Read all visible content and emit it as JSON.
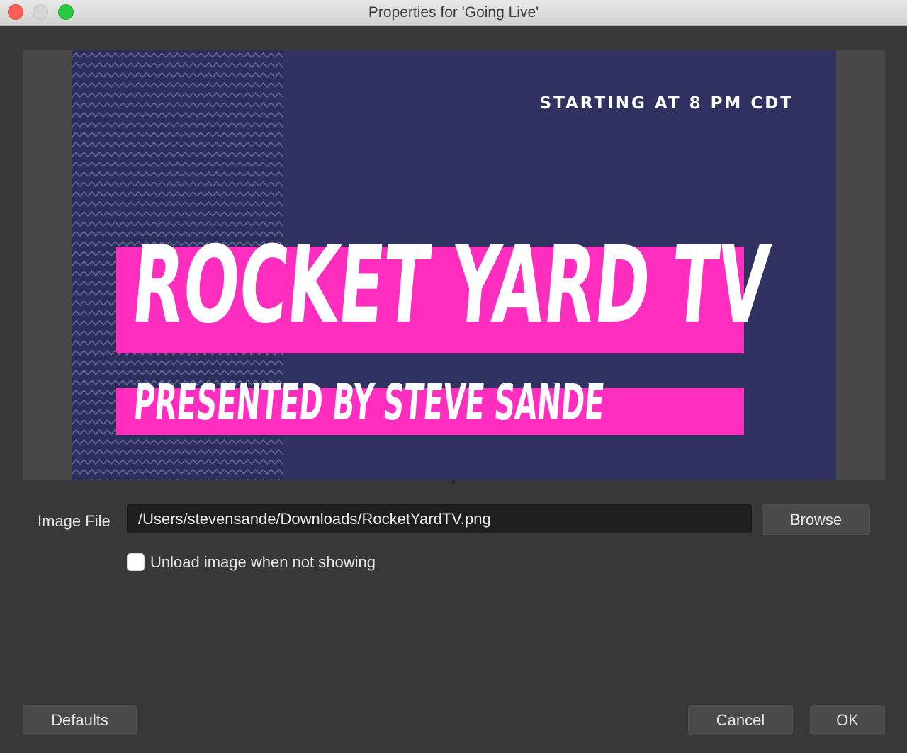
{
  "window": {
    "title": "Properties for 'Going Live'"
  },
  "preview": {
    "starting_text": "STARTING AT 8 PM CDT",
    "headline": "ROCKET YARD TV",
    "subline": "PRESENTED BY STEVE SANDE",
    "colors": {
      "background": "#303262",
      "band": "#ff2ebf",
      "text": "#ffffff"
    }
  },
  "form": {
    "image_file_label": "Image File",
    "image_file_value": "/Users/stevensande/Downloads/RocketYardTV.png",
    "browse_label": "Browse",
    "unload_label": "Unload image when not showing",
    "unload_checked": false
  },
  "footer": {
    "defaults_label": "Defaults",
    "cancel_label": "Cancel",
    "ok_label": "OK"
  },
  "icons": {
    "close": "close-icon",
    "minimize": "minimize-icon",
    "maximize": "maximize-icon"
  }
}
